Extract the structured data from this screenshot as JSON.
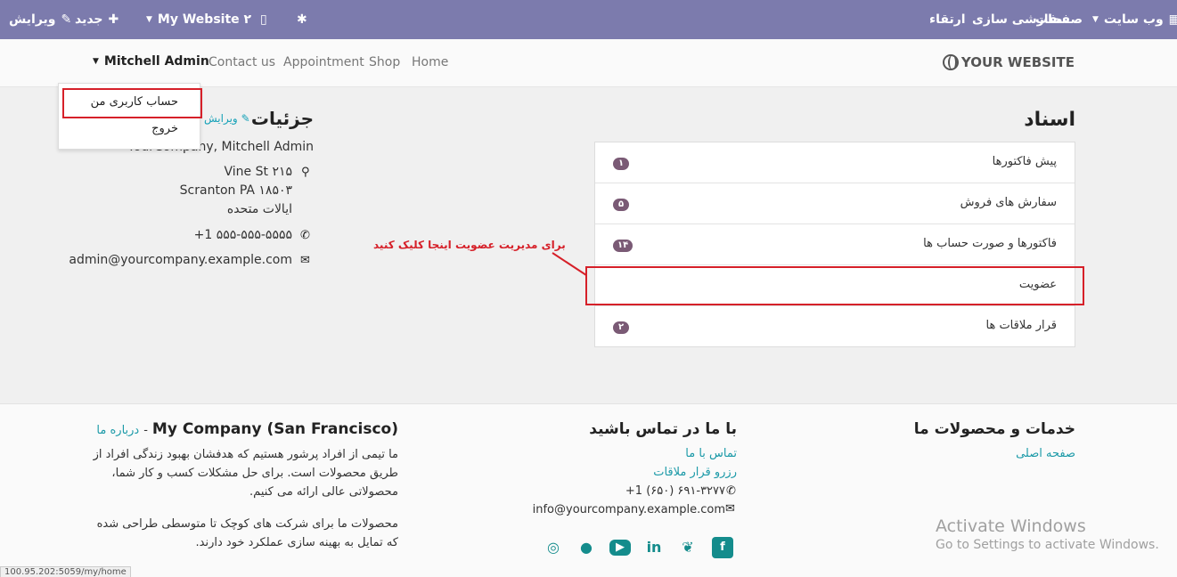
{
  "topbar": {
    "edit": "ویرایش",
    "new": "جدید",
    "website_switch": "My Website ۲",
    "upgrade": "ارتقاء",
    "customize": "سفارشی سازی",
    "pages": "صفحات",
    "website_menu": "وب سایت"
  },
  "header": {
    "user": "Mitchell Admin",
    "nav": [
      "Contact us",
      "Appointment",
      "Shop",
      "Home"
    ],
    "logo": "YOUR WEBSITE"
  },
  "dropdown": {
    "my_account": "حساب کاربری من",
    "logout": "خروج"
  },
  "documents": {
    "title": "اسناد",
    "items": [
      {
        "label": "پیش فاکتورها",
        "count": "۱"
      },
      {
        "label": "سفارش های فروش",
        "count": "۵"
      },
      {
        "label": "فاکتورها و صورت حساب ها",
        "count": "۱۴"
      },
      {
        "label": "عضویت",
        "count": ""
      },
      {
        "label": "قرار ملاقات ها",
        "count": "۲"
      }
    ]
  },
  "details": {
    "title": "جزئیات",
    "edit": "ویرایش",
    "company": "YourCompany, Mitchell Admin",
    "address1": "Vine St ۲۱۵",
    "address2": "Scranton PA ۱۸۵۰۳",
    "country": "ایالات متحده",
    "phone": "+1 ۵۵۵-۵۵۵-۵۵۵۵",
    "email": "admin@yourcompany.example.com"
  },
  "annotation": "برای مدیریت عضویت اینجا کلیک کنید",
  "footer": {
    "services_title": "خدمات و محصولات ما",
    "home_link": "صفحه اصلی",
    "contact_title": "با ما در تماس باشید",
    "contact_link": "تماس با ما",
    "booking_link": "رزرو قرار ملاقات",
    "phone": "+1 (۶۵۰) ۶۹۱-۳۲۷۷",
    "email": "info@yourcompany.example.com",
    "company_title": "My Company (San Francisco)",
    "about_link": "درباره ما",
    "para1": "ما تیمی از افراد پرشور هستیم که هدفشان بهبود زندگی افراد از طریق محصولات است. برای حل مشکلات کسب و کار شما، محصولاتی عالی ارائه می کنیم.",
    "para2": "محصولات ما برای شرکت های کوچک تا متوسطی طراحی شده که تمایل به بهینه سازی عملکرد خود دارند."
  },
  "windows": {
    "line1": "Activate Windows",
    "line2": "Go to Settings to activate Windows."
  },
  "status_url": "100.95.202:5059/my/home"
}
